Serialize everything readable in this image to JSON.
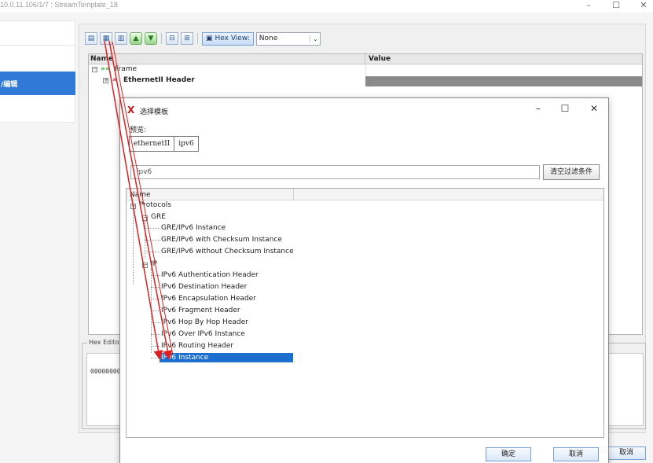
{
  "window": {
    "title": "10.0.11.106/1/7 : StreamTemplate_18",
    "minimize": "–",
    "maximize": "☐",
    "close": "✕"
  },
  "leftnav": {
    "active_label": "/编辑"
  },
  "toolbar": {
    "hex_view_label": "Hex View:",
    "hex_view_value": "None",
    "icons": [
      "add-frame-icon",
      "add-template-icon",
      "insert-icon",
      "move-up-icon",
      "move-down-icon",
      "collapse-icon",
      "expand-icon"
    ]
  },
  "grid": {
    "col_name": "Name",
    "col_value": "Value",
    "rows": [
      {
        "label": "Frame",
        "prefix": "»»"
      },
      {
        "label": "EthernetII Header",
        "prefix": "»"
      }
    ]
  },
  "hex_editor": {
    "label": "Hex Editor",
    "address": "00000000"
  },
  "bottom": {
    "cancel": "取消"
  },
  "dialog": {
    "title": "选择模板",
    "preview_label": "预览:",
    "chips": [
      "ethernetII",
      "ipv6"
    ],
    "filter_value": "ipv6",
    "clear_button": "清空过滤条件",
    "tree_header": "Name",
    "tree": {
      "root": "Protocols",
      "gre": "GRE",
      "gre_items": [
        "GRE/IPv6 Instance",
        "GRE/IPv6 with Checksum Instance",
        "GRE/IPv6 without Checksum Instance"
      ],
      "ip_folder": "IP",
      "ip_items": [
        "IPv6 Authentication Header",
        "IPv6 Destination Header",
        "IPv6 Encapsulation Header",
        "IPv6 Fragment Header",
        "IPv6 Hop By Hop Header",
        "IPv6 Over IPv6 Instance",
        "IPv6 Routing Header",
        "IPv6 Instance"
      ],
      "selected": "IPv6 Instance"
    },
    "ok_button": "确定",
    "cancel_button": "取消"
  },
  "colors": {
    "accent": "#3079d6",
    "selection": "#1d6fcf",
    "logo": "#c41b1b",
    "arrow": "#e02020"
  }
}
